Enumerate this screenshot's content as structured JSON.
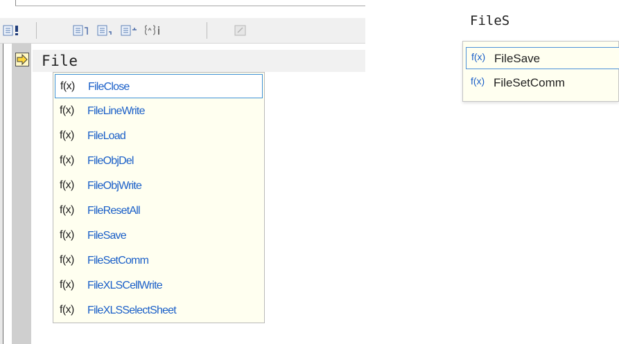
{
  "editor": {
    "current_line_text": "File",
    "toolbar": {
      "buttons": [
        "step-run-icon",
        "step-into-icon",
        "step-over-icon",
        "step-out-icon",
        "watch-icon",
        "edit-icon"
      ]
    }
  },
  "completion_popup_left": {
    "function_prefix": "f(x)",
    "items": [
      {
        "name": "FileClose",
        "selected": true
      },
      {
        "name": "FileLineWrite",
        "selected": false
      },
      {
        "name": "FileLoad",
        "selected": false
      },
      {
        "name": "FileObjDel",
        "selected": false
      },
      {
        "name": "FileObjWrite",
        "selected": false
      },
      {
        "name": "FileResetAll",
        "selected": false
      },
      {
        "name": "FileSave",
        "selected": false
      },
      {
        "name": "FileSetComm",
        "selected": false
      },
      {
        "name": "FileXLSCellWrite",
        "selected": false
      },
      {
        "name": "FileXLSSelectSheet",
        "selected": false
      }
    ]
  },
  "right_panel": {
    "typed_text": "FileS",
    "completion_popup": {
      "function_prefix": "f(x)",
      "items": [
        {
          "name": "FileSave",
          "selected": true
        },
        {
          "name": "FileSetComm",
          "selected": false
        }
      ]
    }
  }
}
